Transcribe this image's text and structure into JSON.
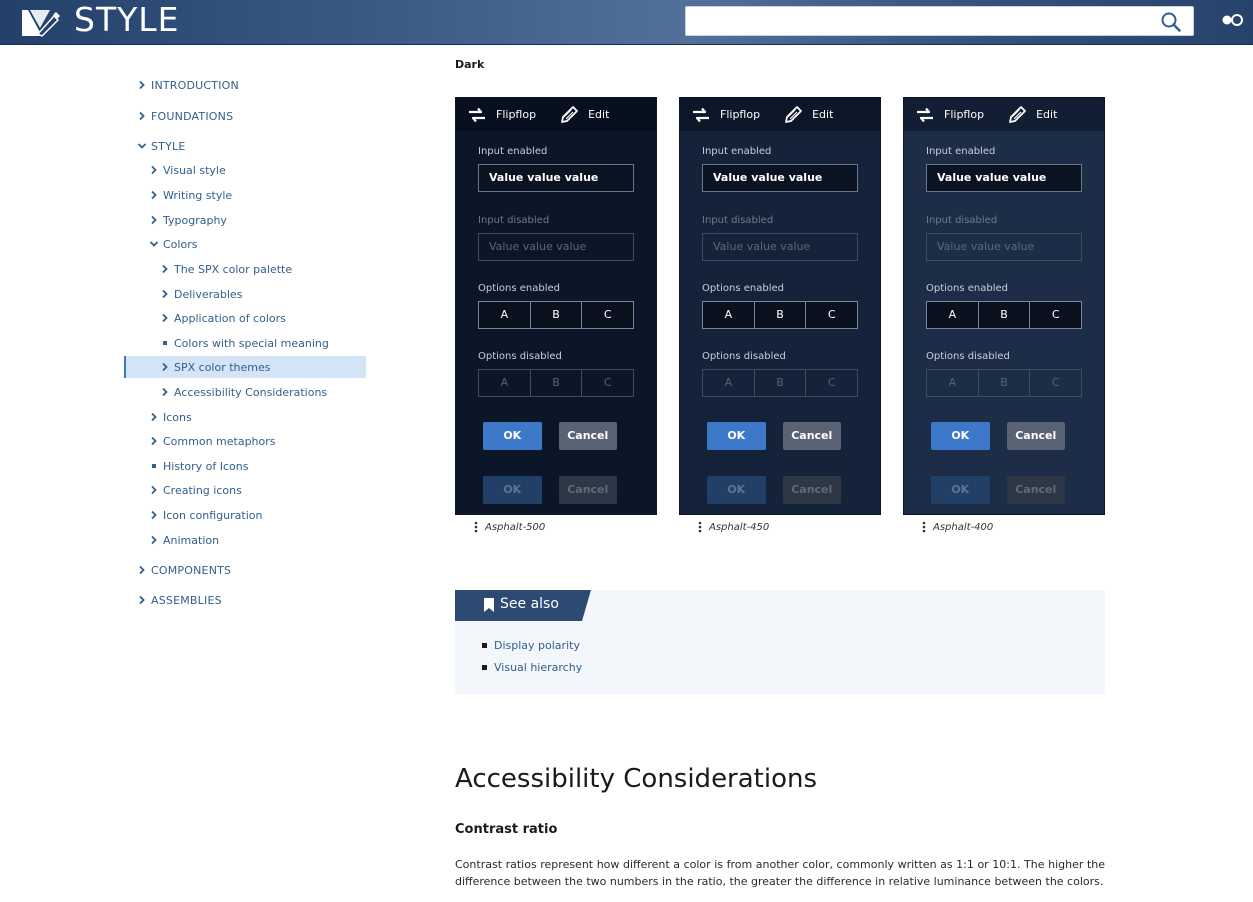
{
  "header": {
    "brand": "STYLE",
    "search_placeholder": ""
  },
  "sidebar": {
    "items": [
      {
        "label": "INTRODUCTION",
        "marker": "chevron-right"
      },
      {
        "label": "FOUNDATIONS",
        "marker": "chevron-right"
      },
      {
        "label": "STYLE",
        "marker": "chevron-down"
      },
      {
        "label": "Visual style",
        "marker": "chevron-right"
      },
      {
        "label": "Writing style",
        "marker": "chevron-right"
      },
      {
        "label": "Typography",
        "marker": "chevron-right"
      },
      {
        "label": "Colors",
        "marker": "chevron-down"
      },
      {
        "label": "The SPX color palette",
        "marker": "chevron-right"
      },
      {
        "label": "Deliverables",
        "marker": "chevron-right"
      },
      {
        "label": "Application of colors",
        "marker": "chevron-right"
      },
      {
        "label": "Colors with special meaning",
        "marker": "bullet"
      },
      {
        "label": "SPX color themes",
        "marker": "chevron-right",
        "selected": true
      },
      {
        "label": "Accessibility Considerations",
        "marker": "chevron-right"
      },
      {
        "label": "Icons",
        "marker": "chevron-right"
      },
      {
        "label": "Common metaphors",
        "marker": "chevron-right"
      },
      {
        "label": "History of Icons",
        "marker": "bullet"
      },
      {
        "label": "Creating icons",
        "marker": "chevron-right"
      },
      {
        "label": "Icon configuration",
        "marker": "chevron-right"
      },
      {
        "label": "Animation",
        "marker": "chevron-right"
      },
      {
        "label": "COMPONENTS",
        "marker": "chevron-right"
      },
      {
        "label": "ASSEMBLIES",
        "marker": "chevron-right"
      }
    ]
  },
  "main": {
    "section_heading": "Dark",
    "panels": [
      {
        "caption": "Asphalt-500",
        "bg": "#0b1629",
        "top_bg": "#07101f"
      },
      {
        "caption": "Asphalt-450",
        "bg": "#15233a",
        "top_bg": "#0c1729"
      },
      {
        "caption": "Asphalt-400",
        "bg": "#1d2d47",
        "top_bg": "#121e33"
      }
    ],
    "panel_content": {
      "flipflop": "Flipflop",
      "edit": "Edit",
      "input_enabled_label": "Input enabled",
      "input_enabled_value": "Value value value",
      "input_disabled_label": "Input disabled",
      "input_disabled_value": "Value value value",
      "options_enabled_label": "Options enabled",
      "options_disabled_label": "Options disabled",
      "options": [
        "A",
        "B",
        "C"
      ],
      "ok": "OK",
      "cancel": "Cancel"
    },
    "see_also": {
      "title": "See also",
      "links": [
        "Display polarity",
        "Visual hierarchy"
      ]
    },
    "accessibility_heading": "Accessibility Considerations",
    "contrast_heading": "Contrast ratio",
    "contrast_paragraph": "Contrast ratios represent how different a color is from another color, commonly written as 1:1 or 10:1. The higher the difference between the two numbers in the ratio, the greater the difference in relative luminance between the colors."
  },
  "colors": {
    "header": "#2f4d78",
    "link": "#315f8e",
    "selected_bg": "#d3e4f7",
    "ok_button": "#3e79c9",
    "cancel_button": "#596373",
    "see_also_tab": "#2d4a73"
  }
}
